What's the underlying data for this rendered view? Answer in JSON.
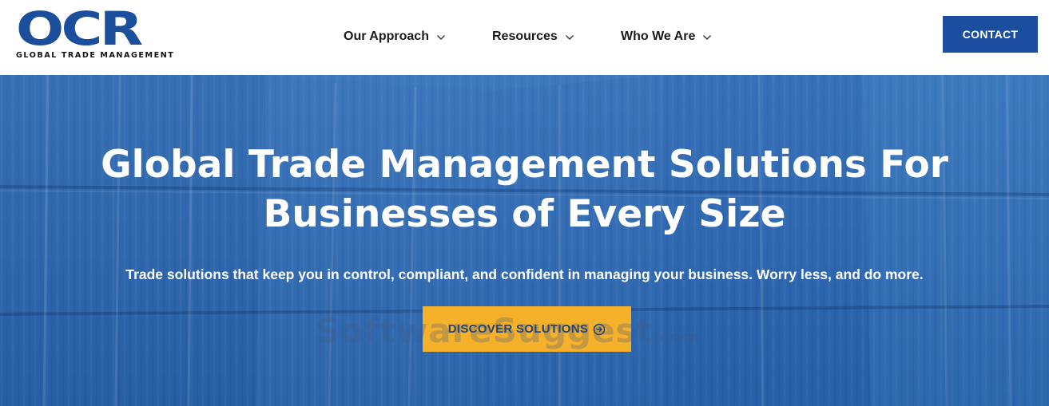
{
  "brand": {
    "logo_mark": "OCR",
    "logo_tagline": "GLOBAL TRADE MANAGEMENT",
    "primary_color": "#1c4e9f",
    "accent_color": "#f6b12a"
  },
  "nav": {
    "items": [
      {
        "label": "Our Approach",
        "icon": "chevron-down-icon"
      },
      {
        "label": "Resources",
        "icon": "chevron-down-icon"
      },
      {
        "label": "Who We Are",
        "icon": "chevron-down-icon"
      }
    ],
    "contact_label": "CONTACT"
  },
  "hero": {
    "title_line1": "Global Trade Management Solutions For",
    "title_line2": "Businesses of Every Size",
    "subtitle": "Trade solutions that keep you in control, compliant, and confident in managing your business. Worry less, and do more.",
    "cta_label": "DISCOVER SOLUTIONS",
    "cta_icon": "arrow-circle-right-icon",
    "background": "shipping-containers-photo"
  },
  "watermark": {
    "text": "SoftwareSuggest",
    "suffix": ".com"
  }
}
